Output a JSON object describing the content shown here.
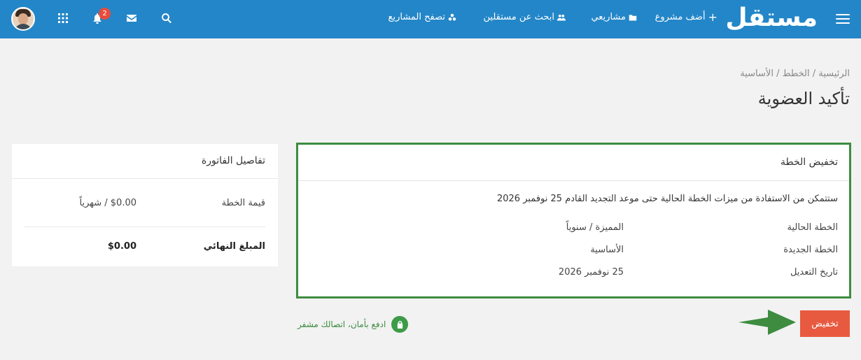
{
  "header": {
    "logo": "مستقل",
    "nav": {
      "add_project": "أضف مشروع",
      "my_projects": "مشاريعي",
      "find_freelancers": "ابحث عن مستقلين",
      "browse_projects": "تصفح المشاريع"
    },
    "notification_count": "2",
    "brand_color": "#2386c8"
  },
  "breadcrumb": {
    "home": "الرئيسية",
    "plans": "الخطط",
    "current": "الأساسية",
    "separator": " / "
  },
  "page_title": "تأكيد العضوية",
  "plan_card": {
    "title": "تخفيض الخطة",
    "description": "ستتمكن من الاستفادة من ميزات الخطة الحالية حتى موعد التجديد القادم 25 نوفمبر 2026",
    "rows": [
      {
        "label": "الخطة الحالية",
        "value": "المميزة / سنوياً"
      },
      {
        "label": "الخطة الجديدة",
        "value": "الأساسية"
      },
      {
        "label": "تاريخ التعديل",
        "value": "25 نوفمبر 2026"
      }
    ],
    "border_color": "#3d8c40"
  },
  "invoice": {
    "title": "تفاصيل الفاتورة",
    "plan_value_label": "قيمة الخطة",
    "plan_value": "$0.00 / شهرياً",
    "total_label": "المبلغ النهائي",
    "total_value": "$0.00"
  },
  "actions": {
    "downgrade_button": "تخفيض",
    "button_color": "#e85a40"
  },
  "secure_note": "ادفع بأمان، اتصالك مشفر",
  "icons": [
    "menu-icon",
    "plus-icon",
    "folder-icon",
    "users-icon",
    "cogs-icon",
    "search-icon",
    "mail-icon",
    "bell-icon",
    "apps-grid-icon",
    "lock-icon",
    "arrow-icon"
  ]
}
